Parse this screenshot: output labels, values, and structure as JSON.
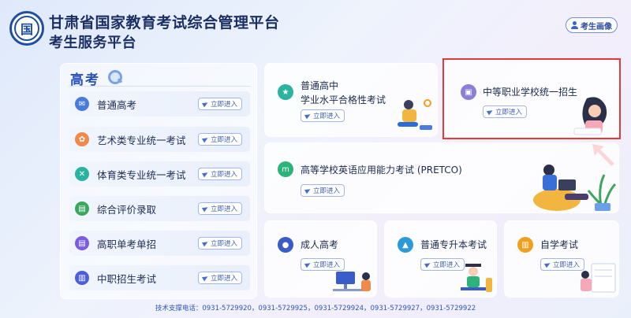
{
  "header": {
    "logo_char": "国",
    "title_line1": "甘肃省国家教育考试综合管理平台",
    "title_line2": "考生服务平台",
    "profile_button": "考生画像"
  },
  "enter_label": "立即进入",
  "gaokao": {
    "section_title": "高考",
    "items": [
      {
        "label": "普通高考",
        "icon": "mail-icon",
        "color": "#4c7be0"
      },
      {
        "label": "艺术类专业统一考试",
        "icon": "art-icon",
        "color": "#f08a4b"
      },
      {
        "label": "体育类专业统一考试",
        "icon": "sport-icon",
        "color": "#2bb3a0"
      },
      {
        "label": "综合评价录取",
        "icon": "document-icon",
        "color": "#3aa75c"
      },
      {
        "label": "高职单考单招",
        "icon": "document-icon",
        "color": "#7a5ce0"
      },
      {
        "label": "中职招生考试",
        "icon": "book-icon",
        "color": "#4c5fd8"
      }
    ]
  },
  "cards": {
    "pt_xueye": {
      "title_line1": "普通高中",
      "title_line2": "学业水平合格性考试",
      "color": "#2bb3a0"
    },
    "zhongzhi": {
      "title": "中等职业学校统一招生",
      "color": "#8b7fd8"
    },
    "pretco": {
      "title": "高等学校英语应用能力考试 (PRETCO)",
      "color": "#2bb37a"
    },
    "chengren": {
      "title": "成人高考",
      "color": "#3a5cc8"
    },
    "zhuanshengben": {
      "title": "普通专升本考试",
      "color": "#2b9ad8"
    },
    "zixue": {
      "title": "自学考试",
      "color": "#f0a020"
    }
  },
  "footer": {
    "support": "技术支撑电话：0931-5729920，0931-5729925，0931-5729924，0931-5729927，0931-5729922"
  }
}
